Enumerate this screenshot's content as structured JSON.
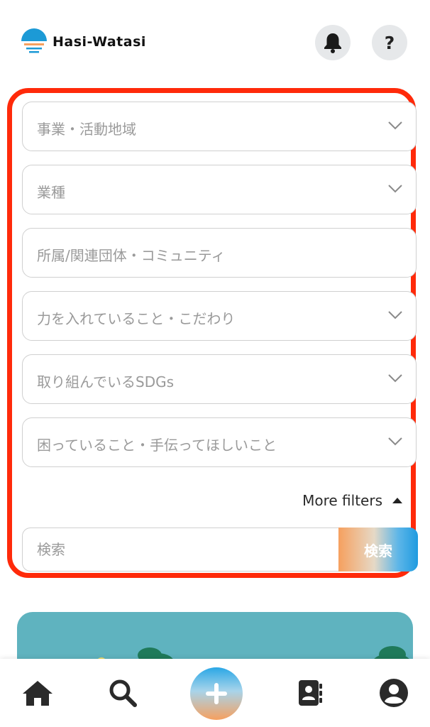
{
  "app": {
    "name": "Hasi-Watasi"
  },
  "header": {
    "help_label": "?"
  },
  "filters": [
    {
      "label": "事業・活動地域",
      "has_dropdown": true
    },
    {
      "label": "業種",
      "has_dropdown": true
    },
    {
      "label": "所属/関連団体・コミュニティ",
      "has_dropdown": false
    },
    {
      "label": "力を入れていること・こだわり",
      "has_dropdown": true
    },
    {
      "label": "取り組んでいるSDGs",
      "has_dropdown": true
    },
    {
      "label": "困っていること・手伝ってほしいこと",
      "has_dropdown": true
    }
  ],
  "more_filters": {
    "label": "More filters"
  },
  "search": {
    "placeholder": "検索",
    "button_label": "検索"
  },
  "nav": {
    "items": [
      "home-icon",
      "search-icon",
      "add-icon",
      "contacts-icon",
      "account-icon"
    ]
  },
  "colors": {
    "highlight": "#ff2a0a",
    "banner": "#5fb3bf",
    "accent_blue": "#1f9be0",
    "accent_orange": "#f6a05f"
  }
}
